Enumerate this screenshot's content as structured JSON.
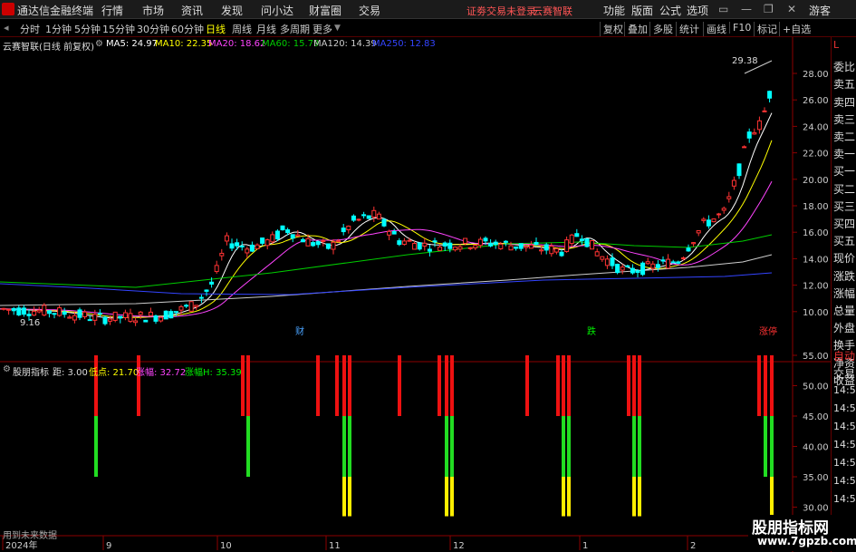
{
  "topbar": {
    "app_title": "通达信金融终端",
    "menu": [
      "行情",
      "市场",
      "资讯",
      "发现",
      "问小达",
      "财富圈",
      "交易"
    ],
    "login_notice": "证劵交易未登录",
    "yunsai": "云赛智联",
    "right_menu": [
      "功能",
      "版面",
      "公式",
      "选项"
    ],
    "guest": "游客"
  },
  "timeframes": {
    "items": [
      "分时",
      "1分钟",
      "5分钟",
      "15分钟",
      "30分钟",
      "60分钟",
      "日线",
      "周线",
      "月线",
      "多周期",
      "更多"
    ],
    "active": "日线"
  },
  "toolbar": {
    "items": [
      "复权",
      "叠加",
      "多股",
      "统计",
      "画线",
      "F10",
      "标记",
      "+自选"
    ]
  },
  "infobar": {
    "stock": "云赛智联(日线 前复权)",
    "ma5": "MA5: 24.97",
    "ma10": "MA10: 22.35",
    "ma20": "MA20: 18.62",
    "ma60": "MA60: 15.79",
    "ma120": "MA120: 14.39",
    "ma250": "MA250: 12.83",
    "ma_colors": {
      "ma5": "#ffffff",
      "ma10": "#ffff00",
      "ma20": "#ff44ff",
      "ma60": "#00cc00",
      "ma120": "#cccccc",
      "ma250": "#3344ff"
    }
  },
  "main_chart": {
    "high_label": "29.38",
    "low_label": "9.16",
    "y_ticks": [
      "28.00",
      "26.00",
      "24.00",
      "22.00",
      "20.00",
      "18.00",
      "16.00",
      "14.00",
      "12.00",
      "10.00"
    ],
    "markers": [
      {
        "text": "财",
        "color": "#4aa3ff"
      },
      {
        "text": "跌",
        "color": "#00ee00"
      },
      {
        "text": "涨停",
        "color": "#ff3333"
      }
    ],
    "up_color": "#ff3333",
    "down_color": "#00ffff"
  },
  "indicator": {
    "name": "股朋指标",
    "ju": "距: 3.00",
    "dian": "低点: 21.70",
    "zhangfu": "涨幅: 32.72",
    "zhangfuh": "涨幅H: 35.39",
    "y_ticks": [
      "55.00",
      "50.00",
      "45.00",
      "40.00",
      "35.00",
      "30.00"
    ],
    "footer": "用到未来数据"
  },
  "x_axis": {
    "labels": [
      "2024年",
      "9",
      "10",
      "11",
      "12",
      "1",
      "2"
    ]
  },
  "rightpanel": {
    "top_items": [
      "L",
      "委比",
      "卖五",
      "卖四",
      "卖三",
      "卖二",
      "卖一",
      "买一",
      "买二",
      "买三",
      "买四",
      "买五",
      "现价",
      "涨跌",
      "涨幅",
      "总量",
      "外盘",
      "换手",
      "净资",
      "收益"
    ],
    "indicator_items": [
      "自动",
      "交易",
      "14:56",
      "14:56",
      "14:56",
      "14:56",
      "14:56",
      "14:56",
      "14:56"
    ]
  },
  "watermark": {
    "title": "股朋指标网",
    "url": "www.7gpzb.com"
  }
}
